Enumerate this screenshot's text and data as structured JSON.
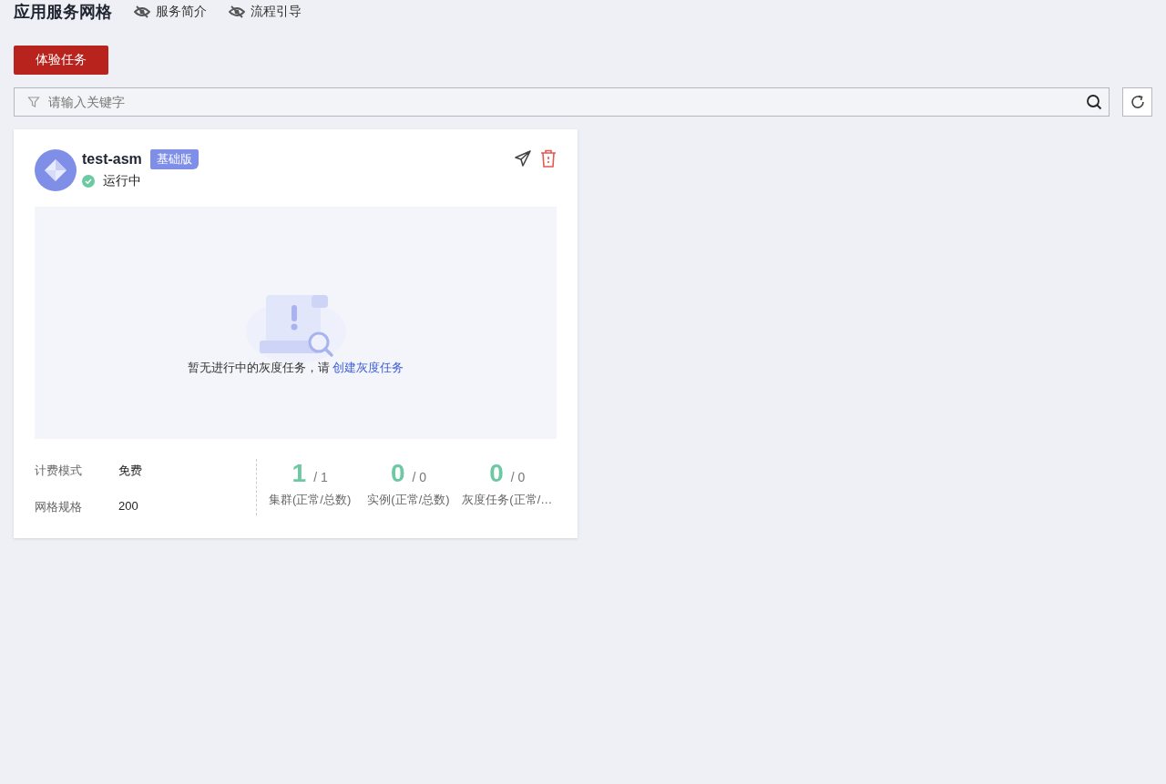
{
  "header": {
    "title": "应用服务网格",
    "links": [
      {
        "label": "服务简介"
      },
      {
        "label": "流程引导"
      }
    ]
  },
  "primary_button": "体验任务",
  "search": {
    "placeholder": "请输入关键字"
  },
  "card": {
    "name": "test-asm",
    "edition": "基础版",
    "status": {
      "label": "运行中",
      "kind": "running"
    },
    "empty": {
      "message": "暂无进行中的灰度任务，请 ",
      "link": "创建灰度任务"
    },
    "info": [
      {
        "label": "计费模式",
        "value": "免费"
      },
      {
        "label": "网格规格",
        "value": "200"
      }
    ],
    "stats": [
      {
        "value": "1",
        "total": "/ 1",
        "label": "集群(正常/总数)"
      },
      {
        "value": "0",
        "total": "/ 0",
        "label": "实例(正常/总数)"
      },
      {
        "value": "0",
        "total": "/ 0",
        "label": "灰度任务(正常/…"
      }
    ]
  }
}
